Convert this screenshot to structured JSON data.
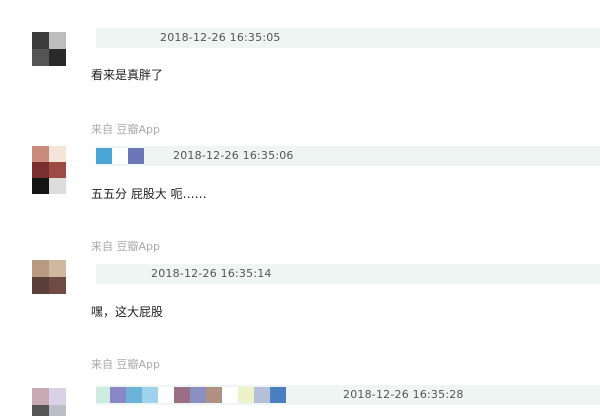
{
  "comments": [
    {
      "timestamp": "2018-12-26 16:35:05",
      "text": "看来是真胖了",
      "avatar_colors": [
        "#3b3b3b",
        "#bdbdbd",
        "#555555",
        "#2a2a2a"
      ]
    },
    {
      "source": "来自 豆瓣App",
      "timestamp": "2018-12-26 16:35:06",
      "text": "五五分 屁股大 呃……",
      "avatar_colors": [
        "#c98c7c",
        "#f4e4da",
        "#7b2e2e",
        "#9e4a44",
        "#141414",
        "#dcdcdc"
      ],
      "name_colors": [
        "#4aa6d6",
        "#ffffff",
        "#6a76b8"
      ]
    },
    {
      "source": "来自 豆瓣App",
      "timestamp": "2018-12-26 16:35:14",
      "text": "嘿，这大屁股",
      "avatar_colors": [
        "#b89a80",
        "#cfb89e",
        "#5a3e37",
        "#6e4b44"
      ]
    },
    {
      "source": "来自 豆瓣App",
      "timestamp": "2018-12-26 16:35:28",
      "avatar_colors": [
        "#c9a9b3",
        "#d9d2e6",
        "#555555",
        "#bdbdc8"
      ],
      "name_colors": [
        "#cfeadf",
        "#8b86c6",
        "#6cb3d8",
        "#9fd3ec",
        "#ffffff",
        "#9a6f86",
        "#8c8fc1",
        "#b09080",
        "#ffffff",
        "#edf3c9",
        "#b3c0d8",
        "#4a7fc1"
      ]
    }
  ]
}
